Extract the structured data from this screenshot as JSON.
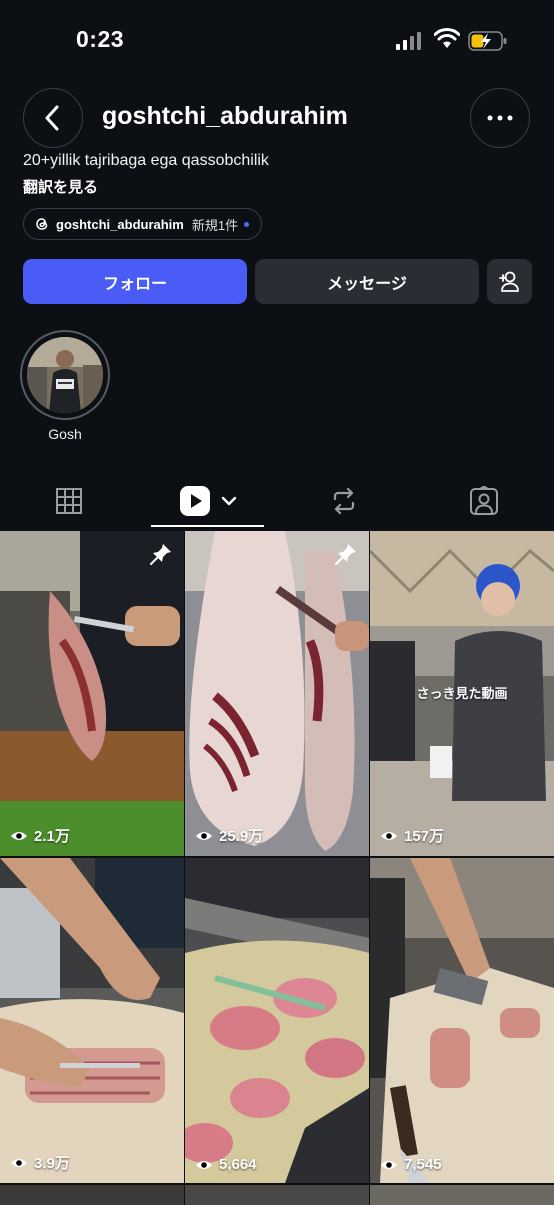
{
  "status": {
    "time": "0:23"
  },
  "header": {
    "username": "goshtchi_abdurahim"
  },
  "profile": {
    "bio": "20+yillik tajribaga ega qassobchilik",
    "translate": "翻訳を見る",
    "threads_name": "goshtchi_abdurahim",
    "threads_new": "新規1件"
  },
  "actions": {
    "follow": "フォロー",
    "message": "メッセージ"
  },
  "highlight": {
    "label": "Gosh"
  },
  "grid": {
    "items": [
      {
        "views": "2.1万",
        "pinned": true
      },
      {
        "views": "25.9万",
        "pinned": true
      },
      {
        "views": "157万",
        "overlay": "さっき見た動画"
      },
      {
        "views": "3.9万"
      },
      {
        "views": "5,664"
      },
      {
        "views": "7,545"
      }
    ]
  },
  "colors": {
    "accent": "#4a5cf6",
    "background": "#0c0f14",
    "button_dark": "#2a2d33"
  }
}
